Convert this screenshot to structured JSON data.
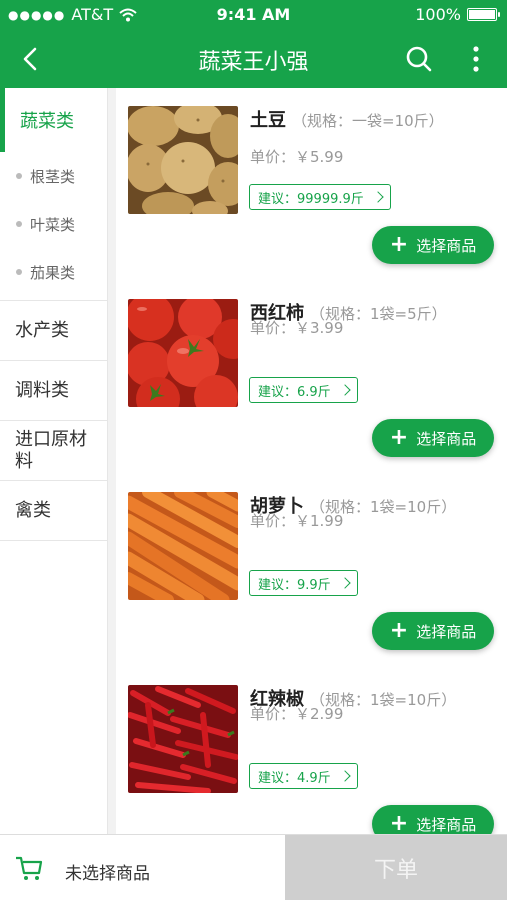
{
  "status": {
    "carrier": "AT&T",
    "time": "9:41 AM",
    "battery": "100%",
    "battery_level": 1.0
  },
  "nav": {
    "title": "蔬菜王小强"
  },
  "sidebar": {
    "main": "蔬菜类",
    "subs": [
      "根茎类",
      "叶菜类",
      "茄果类"
    ],
    "items": [
      "水产类",
      "调料类",
      "进口原材料",
      "禽类"
    ]
  },
  "products": [
    {
      "name": "土豆",
      "spec": "（规格：一袋=10斤）",
      "price": "单价：￥5.99",
      "suggest": "建议：99999.9斤",
      "button": "选择商品",
      "image": "potatoes"
    },
    {
      "name": "西红柿",
      "spec": "（规格：1袋=5斤）",
      "price": "单价：￥3.99",
      "suggest": "建议：6.9斤",
      "button": "选择商品",
      "image": "tomatoes"
    },
    {
      "name": "胡萝卜",
      "spec": "（规格：1袋=10斤）",
      "price": "单价：￥1.99",
      "suggest": "建议：9.9斤",
      "button": "选择商品",
      "image": "carrots"
    },
    {
      "name": "红辣椒",
      "spec": "（规格：1袋=10斤）",
      "price": "单价：￥2.99",
      "suggest": "建议：4.9斤",
      "button": "选择商品",
      "image": "red-chili-peppers"
    }
  ],
  "footer": {
    "cart_text": "未选择商品",
    "order_button": "下单"
  },
  "colors": {
    "brand": "#17a34a",
    "disabled": "#cfcfcf"
  }
}
